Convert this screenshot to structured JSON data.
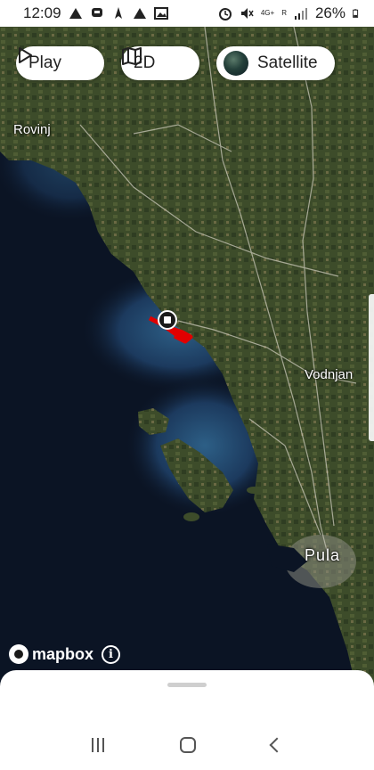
{
  "status_bar": {
    "time": "12:09",
    "battery": "26%",
    "network": "4G+",
    "roaming": "R",
    "left_icons": [
      "warning-icon",
      "chat-icon",
      "navigation-icon",
      "warning-icon",
      "image-icon"
    ],
    "right_icons": [
      "alarm-icon",
      "mute-icon",
      "signal-icon",
      "battery-icon"
    ]
  },
  "map": {
    "labels": {
      "rovinj": "Rovinj",
      "vodnjan": "Vodnjan",
      "pula": "Pula"
    },
    "track_color": "#e10000",
    "sea_color": "#0b1424",
    "land_color": "#3b4a28"
  },
  "controls": {
    "play_label": "Play",
    "view_label": "2D",
    "layer_label": "Satellite"
  },
  "attribution": {
    "logo_text": "mapbox",
    "info": "i"
  },
  "navigation": {
    "recent": "recent-apps-icon",
    "home": "home-icon",
    "back": "back-icon"
  }
}
